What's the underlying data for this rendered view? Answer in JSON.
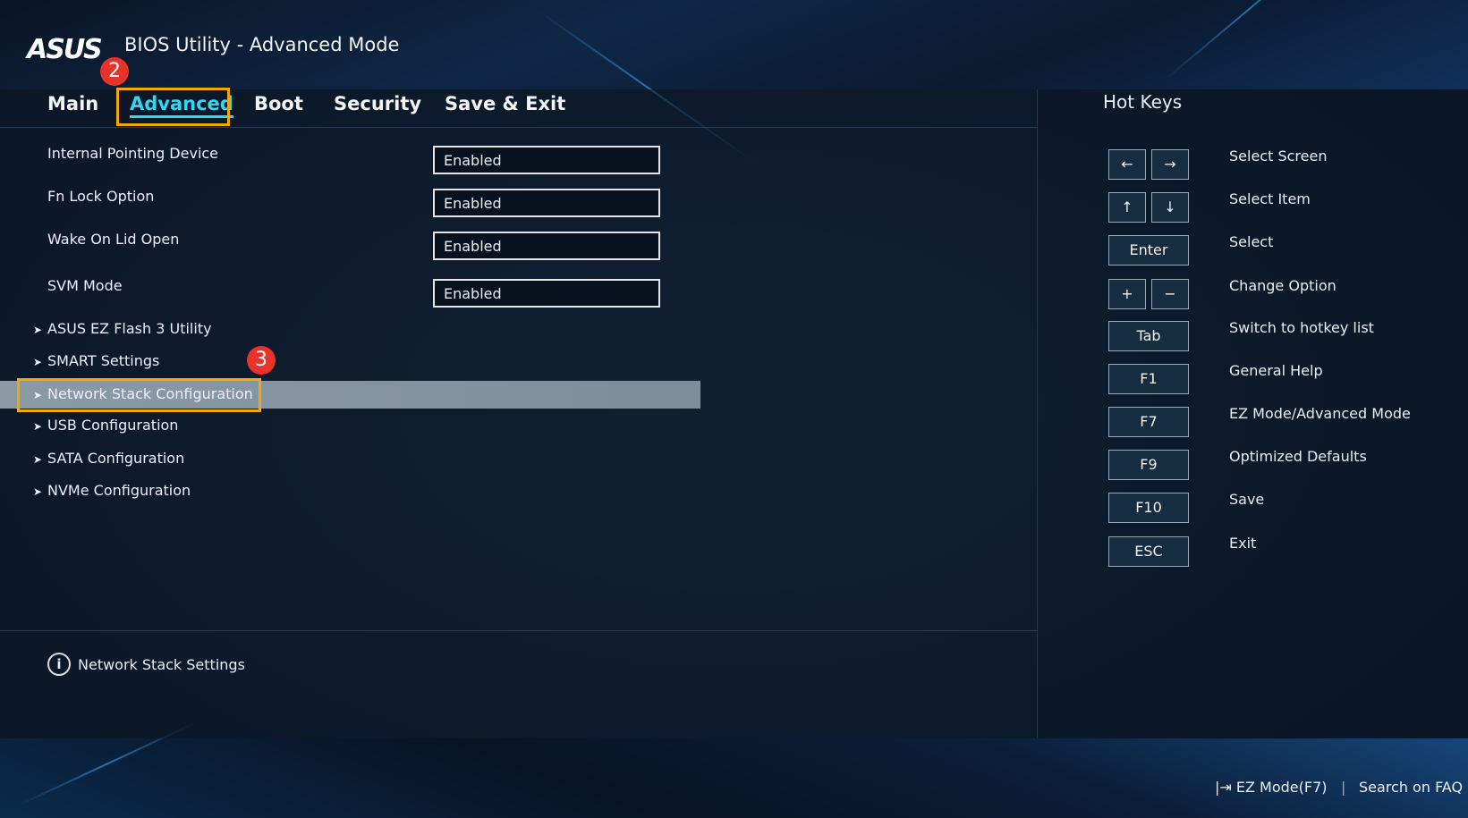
{
  "header": {
    "logo": "ASUS",
    "title": "BIOS Utility - Advanced Mode"
  },
  "tabs": [
    {
      "label": "Main"
    },
    {
      "label": "Advanced",
      "active": true
    },
    {
      "label": "Boot"
    },
    {
      "label": "Security"
    },
    {
      "label": "Save & Exit"
    }
  ],
  "annotations": {
    "step2": "2",
    "step3": "3",
    "highlight_color": "#f5a60a",
    "badge_color": "#e8322a"
  },
  "settings": [
    {
      "label": "Internal Pointing Device",
      "value": "Enabled"
    },
    {
      "label": "Fn Lock Option",
      "value": "Enabled"
    },
    {
      "label": "Wake On Lid Open",
      "value": "Enabled"
    },
    {
      "label": "SVM Mode",
      "value": "Enabled"
    }
  ],
  "submenus": [
    {
      "label": "ASUS EZ Flash 3 Utility"
    },
    {
      "label": "SMART Settings"
    },
    {
      "label": "Network Stack Configuration",
      "selected": true
    },
    {
      "label": "USB Configuration"
    },
    {
      "label": "SATA Configuration"
    },
    {
      "label": "NVMe Configuration"
    }
  ],
  "hotkeys": {
    "title": "Hot Keys",
    "items": [
      {
        "keys": [
          "←",
          "→"
        ],
        "label": "Select Screen"
      },
      {
        "keys": [
          "↑",
          "↓"
        ],
        "label": "Select Item"
      },
      {
        "keys": [
          "Enter"
        ],
        "label": "Select"
      },
      {
        "keys": [
          "+",
          "−"
        ],
        "label": "Change Option"
      },
      {
        "keys": [
          "Tab"
        ],
        "label": "Switch to hotkey list"
      },
      {
        "keys": [
          "F1"
        ],
        "label": "General Help"
      },
      {
        "keys": [
          "F7"
        ],
        "label": "EZ Mode/Advanced Mode"
      },
      {
        "keys": [
          "F9"
        ],
        "label": "Optimized Defaults"
      },
      {
        "keys": [
          "F10"
        ],
        "label": "Save"
      },
      {
        "keys": [
          "ESC"
        ],
        "label": "Exit"
      }
    ]
  },
  "help": {
    "icon": "info-icon",
    "glyph": "i",
    "text": "Network Stack Settings"
  },
  "footer": {
    "ez_mode": "EZ Mode(F7)",
    "ez_icon": "exit-arrow-icon",
    "search": "Search on FAQ",
    "separator": "|"
  }
}
